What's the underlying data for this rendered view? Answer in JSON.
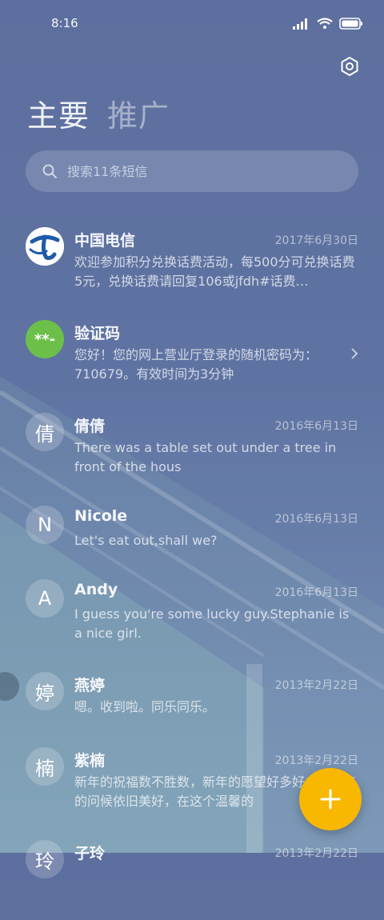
{
  "status_bar": {
    "time": "8:16"
  },
  "tabs": [
    {
      "label": "主要"
    },
    {
      "label": "推广"
    }
  ],
  "search": {
    "placeholder": "搜索11条短信"
  },
  "messages": [
    {
      "name": "中国电信",
      "date": "2017年6月30日",
      "preview": "欢迎参加积分兑换话费活动，每500分可兑换话费5元，兑换话费请回复106或jfdh#话费…",
      "avatar": "telecom-logo"
    },
    {
      "name": "验证码",
      "date": "",
      "preview": "您好！您的网上营业厅登录的随机密码为：710679。有效时间为3分钟",
      "avatar": "**-",
      "avatar_color": "#6cc04a"
    },
    {
      "name": "倩倩",
      "date": "2016年6月13日",
      "preview": "There was a table set out under a tree in front of the hous",
      "avatar": "倩"
    },
    {
      "name": "Nicole",
      "date": "2016年6月13日",
      "preview": "Let's eat out,shall we?",
      "avatar": "N"
    },
    {
      "name": "Andy",
      "date": "2016年6月13日",
      "preview": "I guess you're some lucky guy.Stephanie is a nice girl.",
      "avatar": "A"
    },
    {
      "name": "燕婷",
      "date": "2013年2月22日",
      "preview": "嗯。收到啦。同乐同乐。",
      "avatar": "婷"
    },
    {
      "name": "紫楠",
      "date": "2013年2月22日",
      "preview": "新年的祝福数不胜数，新年的愿望好多好多，新年的问候依旧美好，在这个温馨的",
      "avatar": "楠"
    },
    {
      "name": "子玲",
      "date": "2013年2月22日",
      "preview": "",
      "avatar": "玲"
    }
  ],
  "colors": {
    "fab": "#f8b700",
    "verify_avatar": "#6cc04a",
    "telecom_blue": "#1e5aa8"
  },
  "icons": {
    "settings": "settings-icon",
    "search": "search-icon",
    "compose": "plus-icon"
  }
}
